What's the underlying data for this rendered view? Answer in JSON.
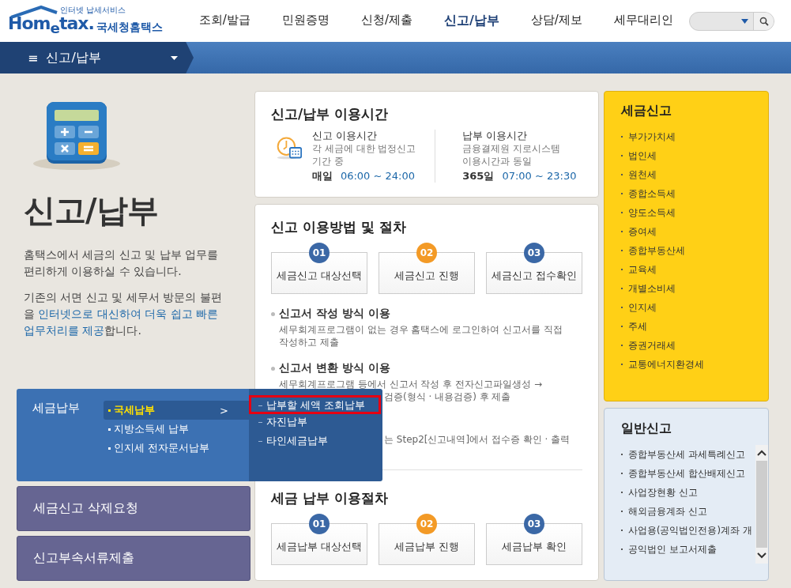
{
  "header": {
    "logo": {
      "tagline": "인터넷 납세서비스",
      "brand": "Hom$_{e}$tax.",
      "suffix": "국세청홈택스"
    },
    "nav": [
      {
        "label": "조회/발급",
        "selected": false
      },
      {
        "label": "민원증명",
        "selected": false
      },
      {
        "label": "신청/제출",
        "selected": false
      },
      {
        "label": "신고/납부",
        "selected": true
      },
      {
        "label": "상담/제보",
        "selected": false
      },
      {
        "label": "세무대리인",
        "selected": false
      }
    ]
  },
  "breadcrumb": {
    "menu_icon": "≡",
    "label": "신고/납부"
  },
  "intro": {
    "title": "신고/납부",
    "paragraphs": [
      [
        {
          "text": "홈택스에서 세금의 신고 및 납부 업무를 편리하게 이용하실 수 있습니다.",
          "highlight": false
        }
      ],
      [
        {
          "text": "기존의 서면 신고 및 세무서 방문의 불편을 ",
          "highlight": false
        },
        {
          "text": "인터넷으로 대신하여 더욱 쉽고 빠른 업무처리를 제공",
          "highlight": true
        },
        {
          "text": "합니다.",
          "highlight": false
        }
      ]
    ]
  },
  "pay_menu": {
    "title": "세금납부",
    "items": [
      {
        "label": "국세납부",
        "selected": true,
        "arrow": ">"
      },
      {
        "label": "지방소득세 납부",
        "selected": false
      },
      {
        "label": "인지세 전자문서납부",
        "selected": false
      }
    ],
    "submenu": [
      {
        "label": "납부할 세액 조회납부",
        "selected": true
      },
      {
        "label": "자진납부",
        "selected": false
      },
      {
        "label": "타인세금납부",
        "selected": false
      }
    ]
  },
  "side_buttons": [
    "세금신고 삭제요청",
    "신고부속서류제출"
  ],
  "usage_time": {
    "title": "신고/납부 이용시간",
    "columns": [
      {
        "title": "신고 이용시간",
        "lines": [
          "각 세금에 대한 법정신고",
          "기간 중"
        ],
        "day": "매일",
        "hours": "06:00 ~ 24:00"
      },
      {
        "title": "납부 이용시간",
        "lines": [
          "금융결제원 지로시스템",
          "이용시간과 동일"
        ],
        "day": "365일",
        "hours": "07:00 ~ 23:30"
      }
    ]
  },
  "report_procedure": {
    "title": "신고 이용방법 및 절차",
    "steps": [
      {
        "number": "01",
        "label": "세금신고 대상선택",
        "color": "#3b68a6"
      },
      {
        "number": "02",
        "label": "세금신고 진행",
        "color": "#f39a26"
      },
      {
        "number": "03",
        "label": "세금신고 접수확인",
        "color": "#3b68a6"
      }
    ],
    "methods": [
      {
        "title": "신고서 작성 방식 이용",
        "lines": [
          {
            "text": "세무회계프로그램이 없는 경우 홈택스에 로그인하여 신고서를 직접",
            "kind": "full"
          },
          {
            "text": "작성하고 제출",
            "kind": "full"
          }
        ]
      },
      {
        "title": "신고서 변환 방식 이용",
        "lines": [
          {
            "text": "세무회계프로그램 등에서 신고서 작성 후 전자신고파일생성 →",
            "kind": "full"
          },
          {
            "text": "검증(형식 · 내용검증) 후 제출",
            "kind": "partial"
          }
        ]
      },
      {
        "lines": [
          {
            "text": "는 Step2[신고내역]에서 접수증 확인 · 출력",
            "kind": "partial"
          }
        ]
      }
    ]
  },
  "payment_procedure": {
    "title": "세금 납부 이용절차",
    "steps": [
      {
        "number": "01",
        "label": "세금납부 대상선택",
        "color": "#3b68a6"
      },
      {
        "number": "02",
        "label": "세금납부 진행",
        "color": "#f39a26"
      },
      {
        "number": "03",
        "label": "세금납부 확인",
        "color": "#3b68a6"
      }
    ]
  },
  "tax_report": {
    "title": "세금신고",
    "items": [
      "부가가치세",
      "법인세",
      "원천세",
      "종합소득세",
      "양도소득세",
      "증여세",
      "종합부동산세",
      "교육세",
      "개별소비세",
      "인지세",
      "주세",
      "증권거래세",
      "교통에너지환경세"
    ]
  },
  "general_report": {
    "title": "일반신고",
    "items": [
      "종합부동산세 과세특례신고",
      "종합부동산세 합산배제신고",
      "사업장현황 신고",
      "해외금융계좌 신고",
      "사업용(공익법인전용)계좌 개",
      "공익법인 보고서제출"
    ]
  }
}
